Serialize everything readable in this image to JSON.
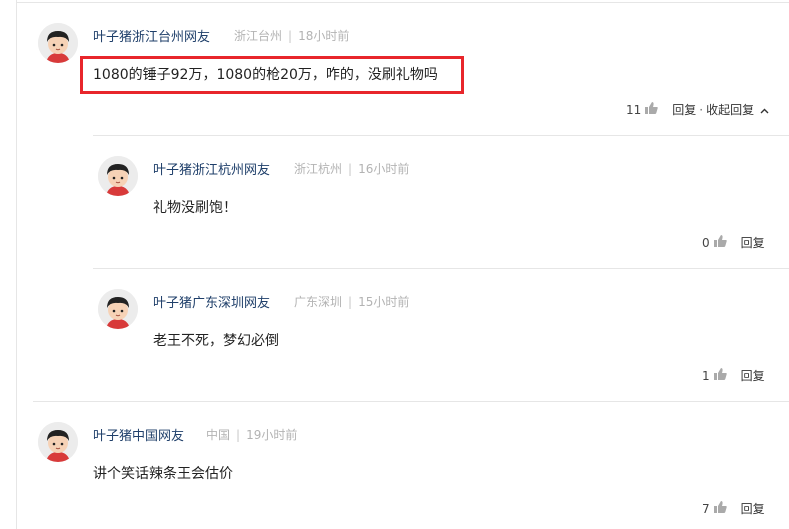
{
  "comments": [
    {
      "user": "叶子猪浙江台州网友",
      "location": "浙江台州",
      "time": "18小时前",
      "text": "1080的锤子92万，1080的枪20万，咋的，没刷礼物吗",
      "likes": "11",
      "reply_label": "回复",
      "collapse_label": "收起回复"
    },
    {
      "user": "叶子猪浙江杭州网友",
      "location": "浙江杭州",
      "time": "16小时前",
      "text": "礼物没刷饱！",
      "likes": "0",
      "reply_label": "回复"
    },
    {
      "user": "叶子猪广东深圳网友",
      "location": "广东深圳",
      "time": "15小时前",
      "text": "老王不死，梦幻必倒",
      "likes": "1",
      "reply_label": "回复"
    },
    {
      "user": "叶子猪中国网友",
      "location": "中国",
      "time": "19小时前",
      "text": "讲个笑话辣条王会估价",
      "likes": "7",
      "reply_label": "回复"
    }
  ],
  "colors": {
    "username": "#1f3f6a",
    "meta": "#b3b3b3",
    "highlight": "#e8262b"
  },
  "icons": {
    "like": "thumbs-up-icon",
    "collapse": "chevron-up-icon",
    "avatar": "cartoon-boy-avatar"
  }
}
